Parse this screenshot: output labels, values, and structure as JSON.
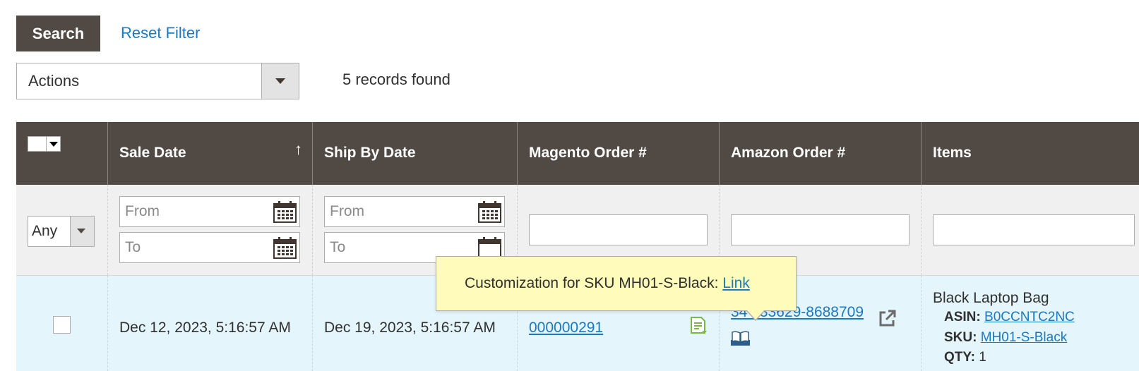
{
  "toolbar": {
    "search_label": "Search",
    "reset_filter_label": "Reset Filter",
    "actions_label": "Actions",
    "records_found": "5 records found"
  },
  "grid": {
    "headers": [
      {
        "label": ""
      },
      {
        "label": "Sale Date",
        "sort": "↑"
      },
      {
        "label": "Ship By Date"
      },
      {
        "label": "Magento Order #"
      },
      {
        "label": "Amazon Order #"
      },
      {
        "label": "Items"
      }
    ],
    "filters": {
      "status_selected": "Any",
      "sale_date_from_placeholder": "From",
      "sale_date_to_placeholder": "To",
      "ship_date_from_placeholder": "From",
      "ship_date_to_placeholder": "To",
      "magento_order_value": "",
      "amazon_order_value": "",
      "items_value": ""
    },
    "rows": [
      {
        "checked": false,
        "sale_date": "Dec 12, 2023, 5:16:57 AM",
        "ship_by_date": "Dec 19, 2023, 5:16:57 AM",
        "magento_order": "000000291",
        "amazon_order": "34  433629-8688709",
        "item_name": "Black Laptop Bag",
        "asin_label": "ASIN:",
        "asin": "B0CCNTC2NC",
        "sku_label": "SKU:",
        "sku": "MH01-S-Black",
        "qty_label": "QTY:",
        "qty": "1"
      }
    ]
  },
  "tooltip": {
    "text": "Customization for SKU MH01-S-Black: ",
    "link_label": "Link"
  },
  "colors": {
    "header_bg": "#514943",
    "filter_bg": "#f0f0f0",
    "row_bg": "#e5f5fc",
    "link": "#1979c3",
    "tooltip_bg": "#fffbbb"
  },
  "icons": [
    "calendar-icon",
    "chevron-down-icon",
    "note-icon",
    "book-icon",
    "external-link-icon",
    "sort-arrow-icon"
  ]
}
